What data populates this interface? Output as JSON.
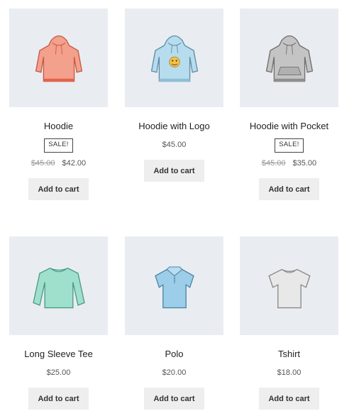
{
  "products": [
    {
      "name": "Hoodie",
      "badge": "SALE!",
      "old_price": "$45.00",
      "price": "$42.00",
      "button": "Add to cart",
      "color": "#f08f7a",
      "icon": "hoodie-icon"
    },
    {
      "name": "Hoodie with Logo",
      "price": "$45.00",
      "button": "Add to cart",
      "color": "#a6d3e8",
      "icon": "hoodie-logo-icon"
    },
    {
      "name": "Hoodie with Pocket",
      "badge": "SALE!",
      "old_price": "$45.00",
      "price": "$35.00",
      "button": "Add to cart",
      "color": "#b3b3b3",
      "icon": "hoodie-pocket-icon"
    },
    {
      "name": "Long Sleeve Tee",
      "price": "$25.00",
      "button": "Add to cart",
      "color": "#8fd9c2",
      "icon": "long-sleeve-tee-icon"
    },
    {
      "name": "Polo",
      "price": "$20.00",
      "button": "Add to cart",
      "color": "#8cc3e6",
      "icon": "polo-icon"
    },
    {
      "name": "Tshirt",
      "price": "$18.00",
      "button": "Add to cart",
      "color": "#dedede",
      "icon": "tshirt-icon"
    }
  ]
}
